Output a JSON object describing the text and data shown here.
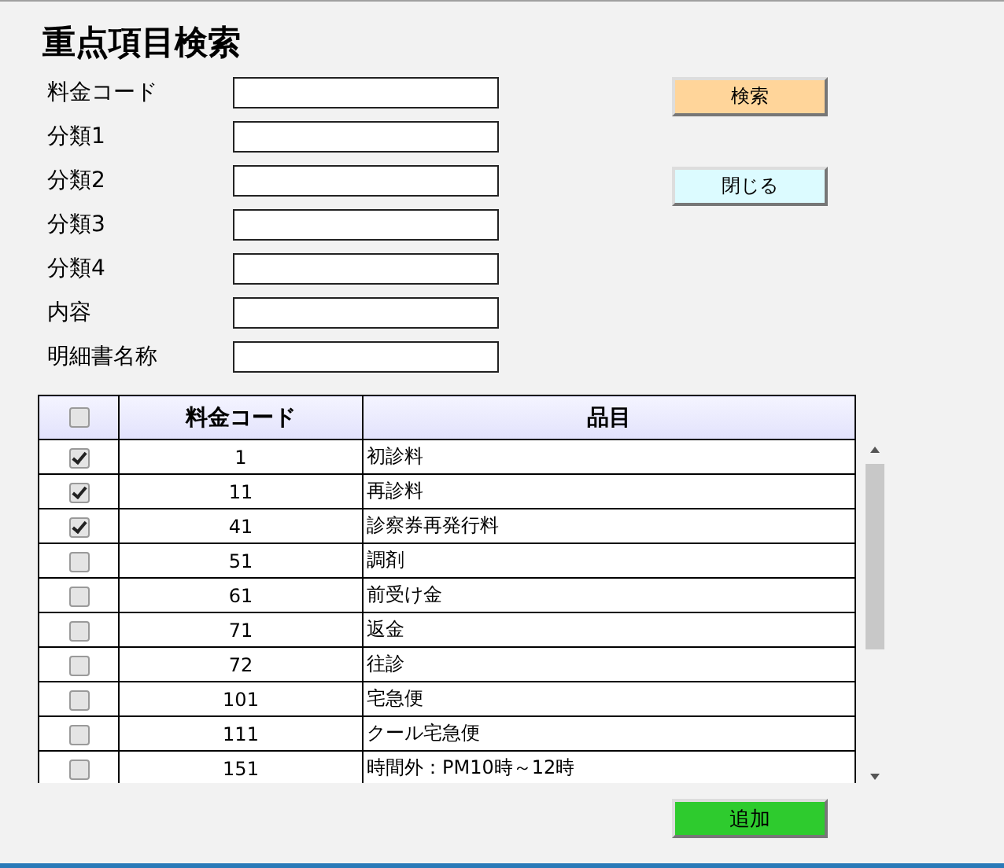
{
  "title": "重点項目検索",
  "fields": [
    {
      "label": "料金コード"
    },
    {
      "label": "分類1"
    },
    {
      "label": "分類2"
    },
    {
      "label": "分類3"
    },
    {
      "label": "分類4"
    },
    {
      "label": "内容"
    },
    {
      "label": "明細書名称"
    }
  ],
  "buttons": [
    {
      "label": "検索",
      "kind": "search"
    },
    {
      "label": "閉じる",
      "kind": "close"
    }
  ],
  "table": {
    "select_all_checked": false,
    "columns": [
      "料金コード",
      "品目"
    ],
    "rows": [
      {
        "checked": true,
        "code": "1",
        "item": "初診料"
      },
      {
        "checked": true,
        "code": "11",
        "item": "再診料"
      },
      {
        "checked": true,
        "code": "41",
        "item": "診察券再発行料"
      },
      {
        "checked": false,
        "code": "51",
        "item": "調剤"
      },
      {
        "checked": false,
        "code": "61",
        "item": "前受け金"
      },
      {
        "checked": false,
        "code": "71",
        "item": "返金"
      },
      {
        "checked": false,
        "code": "72",
        "item": "往診"
      },
      {
        "checked": false,
        "code": "101",
        "item": "宅急便"
      },
      {
        "checked": false,
        "code": "111",
        "item": "クール宅急便"
      },
      {
        "checked": false,
        "code": "151",
        "item": "時間外：PM10時～12時"
      }
    ]
  },
  "add_button": "追加"
}
